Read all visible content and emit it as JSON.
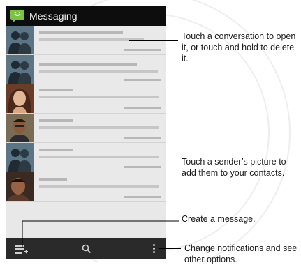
{
  "app": {
    "title": "Messaging",
    "accent_color": "#7cc242",
    "app_icon": "messaging-bubble-icon"
  },
  "conversations": [
    {
      "avatar": "default-contact-icon"
    },
    {
      "avatar": "default-contact-icon"
    },
    {
      "avatar": "contact-photo-woman"
    },
    {
      "avatar": "contact-photo-man"
    },
    {
      "avatar": "default-contact-icon"
    },
    {
      "avatar": "contact-photo-man-2"
    }
  ],
  "bottom_bar": {
    "compose_icon": "compose-message-icon",
    "search_icon": "search-icon",
    "menu_icon": "overflow-menu-icon"
  },
  "callouts": {
    "conversation": "Touch a conversation to open it, or touch and hold to delete it.",
    "picture": "Touch a sender’s picture to add them to your contacts.",
    "create": "Create a message.",
    "menu": "Change notifications and see other options."
  }
}
